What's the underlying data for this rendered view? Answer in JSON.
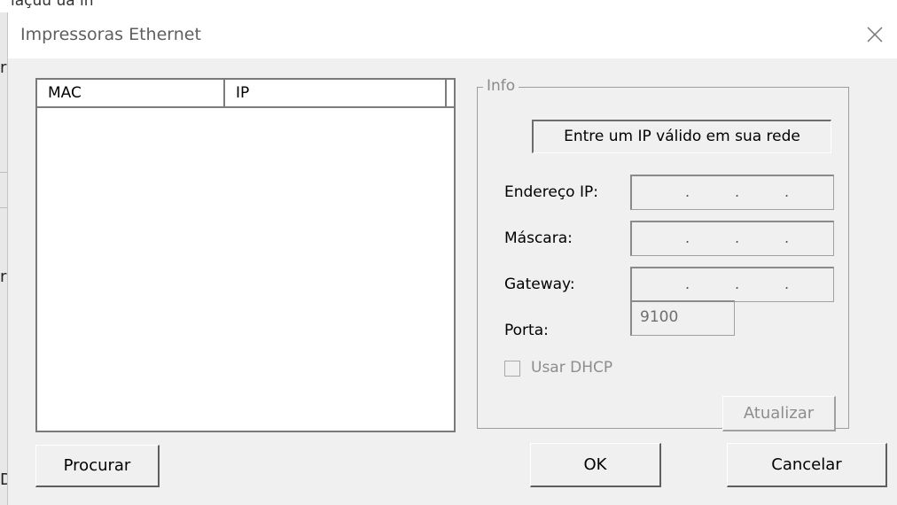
{
  "background": {
    "top_fragment": "ıaçuu ua ın",
    "left_glyphs": [
      "r",
      "r",
      "D"
    ]
  },
  "dialog": {
    "title": "Impressoras Ethernet",
    "close_icon": "close-icon"
  },
  "printer_list": {
    "columns": [
      "MAC",
      "IP"
    ],
    "rows": []
  },
  "info_group": {
    "legend": "Info",
    "hint": "Entre um IP válido em sua rede",
    "ip_label": "Endereço IP:",
    "mask_label": "Máscara:",
    "gateway_label": "Gateway:",
    "port_label": "Porta:",
    "port_value": "9100",
    "dhcp_label": "Usar DHCP",
    "dhcp_checked": false,
    "update_button": "Atualizar"
  },
  "buttons": {
    "search": "Procurar",
    "ok": "OK",
    "cancel": "Cancelar"
  }
}
